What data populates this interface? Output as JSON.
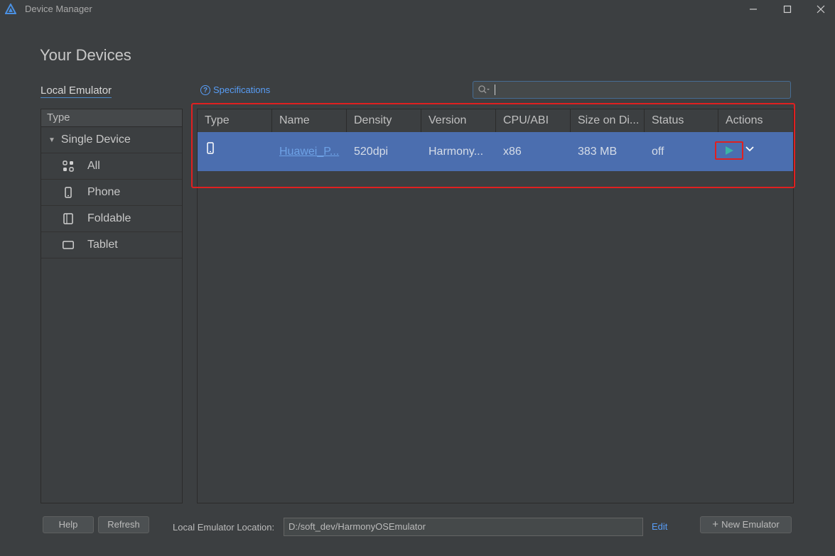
{
  "window": {
    "title": "Device Manager",
    "icons": {
      "app": "harmony-logo-icon",
      "minimize": "minimize-icon",
      "maximize": "maximize-icon",
      "close": "close-icon"
    }
  },
  "page": {
    "title": "Your Devices"
  },
  "tabs": {
    "local_emulator": "Local Emulator"
  },
  "specifications_link": "Specifications",
  "search": {
    "value": ""
  },
  "type_panel": {
    "header": "Type",
    "group": "Single Device",
    "items": [
      {
        "label": "All",
        "icon": "grid-icon"
      },
      {
        "label": "Phone",
        "icon": "phone-icon"
      },
      {
        "label": "Foldable",
        "icon": "foldable-icon"
      },
      {
        "label": "Tablet",
        "icon": "tablet-icon"
      }
    ]
  },
  "table": {
    "columns": [
      "Type",
      "Name",
      "Density",
      "Version",
      "CPU/ABI",
      "Size on Di...",
      "Status",
      "Actions"
    ],
    "rows": [
      {
        "type_icon": "phone-icon",
        "name": "Huawei_P...",
        "density": "520dpi",
        "version": "Harmony...",
        "cpu": "x86",
        "size": "383 MB",
        "status": "off"
      }
    ]
  },
  "footer": {
    "help": "Help",
    "refresh": "Refresh",
    "location_label": "Local Emulator Location:",
    "location_value": "D:/soft_dev/HarmonyOSEmulator",
    "edit": "Edit",
    "new_emulator": "New Emulator"
  },
  "colors": {
    "background": "#3c3f41",
    "selection": "#4b6eaf",
    "link": "#589df6",
    "highlight": "#e02020",
    "play": "#3cb5a5"
  }
}
